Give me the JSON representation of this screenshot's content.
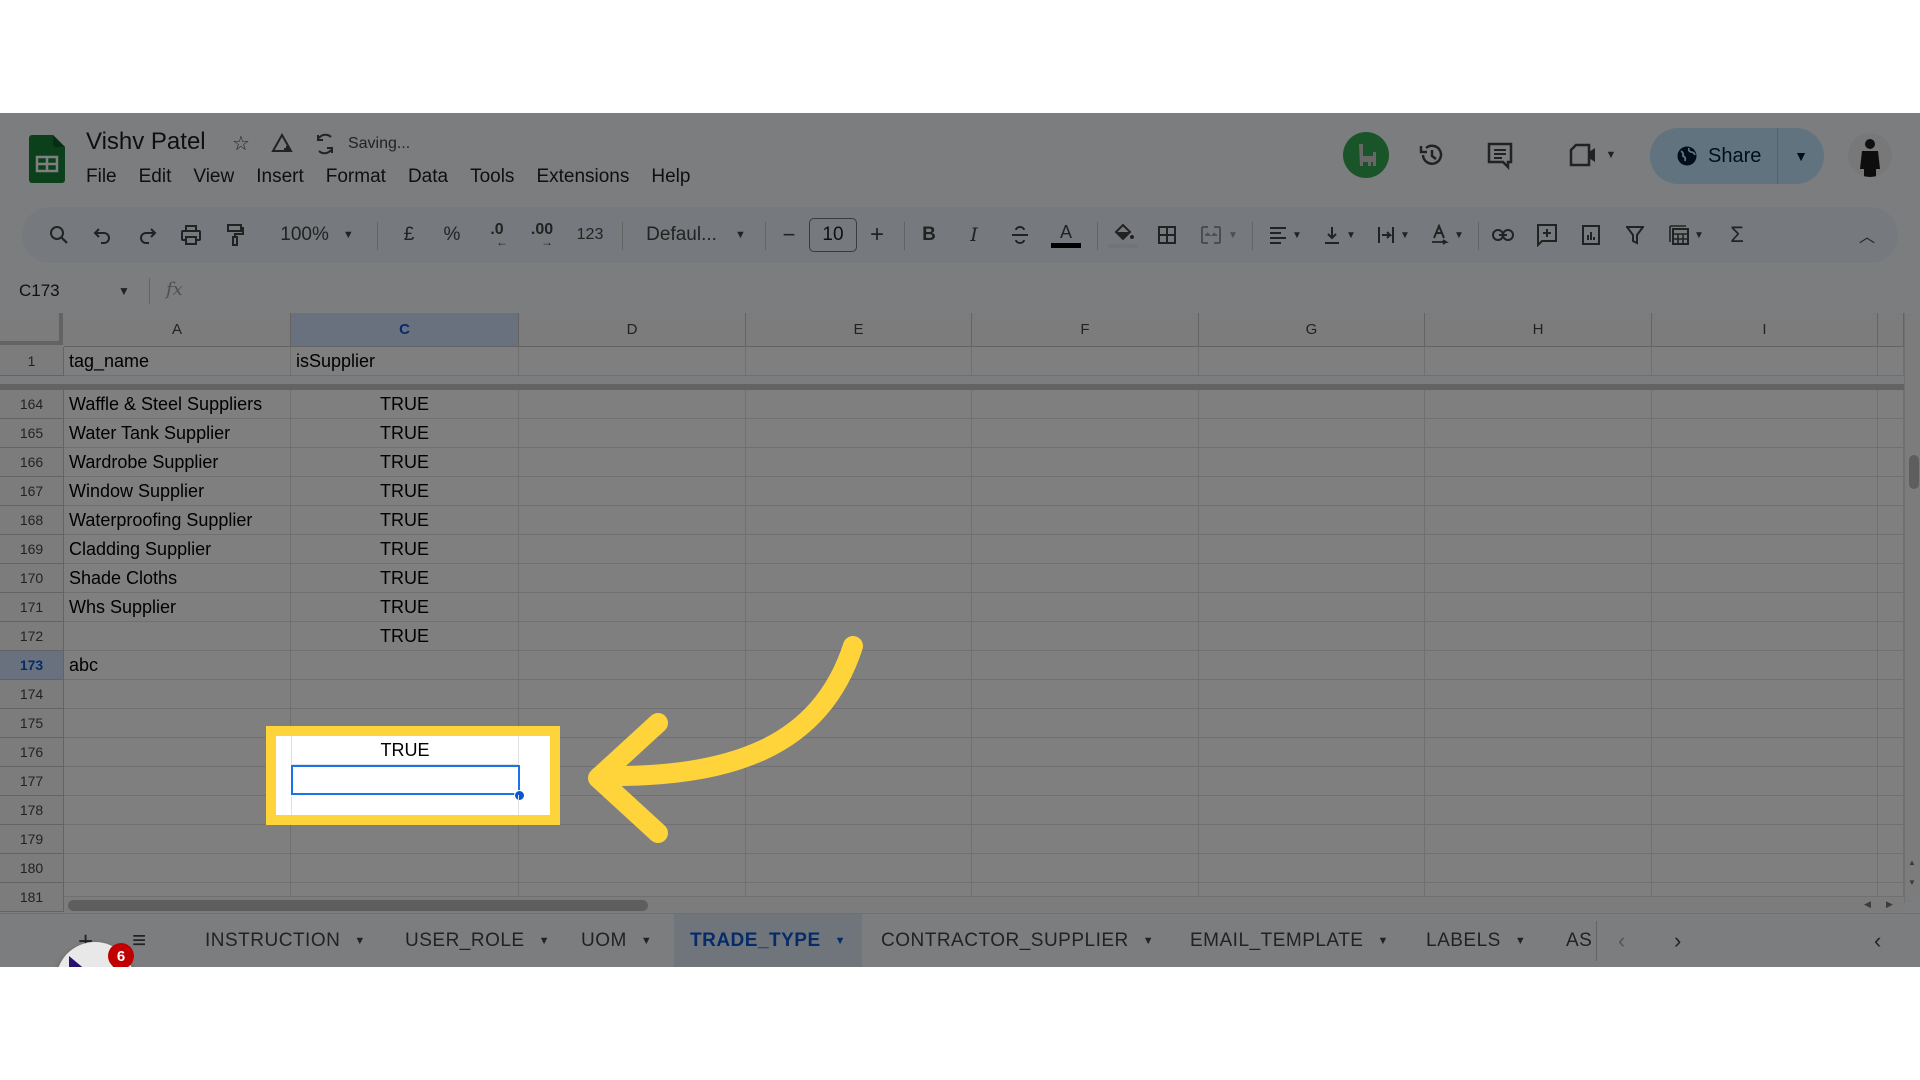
{
  "app": {
    "doc_title": "Vishv Patel",
    "save_status": "Saving...",
    "menu": [
      "File",
      "Edit",
      "View",
      "Insert",
      "Format",
      "Data",
      "Tools",
      "Extensions",
      "Help"
    ],
    "share_label": "Share"
  },
  "toolbar": {
    "zoom": "100%",
    "currency": "£",
    "percent": "%",
    "dec_decrease": ".0",
    "dec_increase": ".00",
    "number_format": "123",
    "font": "Defaul...",
    "font_size": "10",
    "minus": "−",
    "plus": "+",
    "bold": "B",
    "italic": "I",
    "sum": "Σ"
  },
  "formula_bar": {
    "name_box": "C173",
    "fx": "fx",
    "value": ""
  },
  "grid": {
    "columns": [
      "A",
      "C",
      "D",
      "E",
      "F",
      "G",
      "H",
      "I"
    ],
    "selected_column": "C",
    "header_row": {
      "row": "1",
      "A": "tag_name",
      "C": "isSupplier"
    },
    "rows": [
      {
        "row": "164",
        "A": "Waffle & Steel Suppliers",
        "C": "TRUE"
      },
      {
        "row": "165",
        "A": "Water Tank Supplier",
        "C": "TRUE"
      },
      {
        "row": "166",
        "A": "Wardrobe Supplier",
        "C": "TRUE"
      },
      {
        "row": "167",
        "A": "Window Supplier",
        "C": "TRUE"
      },
      {
        "row": "168",
        "A": "Waterproofing Supplier",
        "C": "TRUE"
      },
      {
        "row": "169",
        "A": "Cladding Supplier",
        "C": "TRUE"
      },
      {
        "row": "170",
        "A": "Shade Cloths",
        "C": "TRUE"
      },
      {
        "row": "171",
        "A": "Whs Supplier",
        "C": "TRUE"
      },
      {
        "row": "172",
        "A": "",
        "C": "TRUE"
      },
      {
        "row": "173",
        "A": "abc",
        "C": ""
      },
      {
        "row": "174",
        "A": "",
        "C": ""
      },
      {
        "row": "175",
        "A": "",
        "C": ""
      },
      {
        "row": "176",
        "A": "",
        "C": ""
      },
      {
        "row": "177",
        "A": "",
        "C": ""
      },
      {
        "row": "178",
        "A": "",
        "C": ""
      },
      {
        "row": "179",
        "A": "",
        "C": ""
      },
      {
        "row": "180",
        "A": "",
        "C": ""
      },
      {
        "row": "181",
        "A": "",
        "C": ""
      }
    ],
    "selected_row": "173",
    "active_cell": "C173"
  },
  "sheets": {
    "add_label": "+",
    "list_label": "≡",
    "tabs": [
      "INSTRUCTION",
      "USER_ROLE",
      "UOM",
      "TRADE_TYPE",
      "CONTRACTOR_SUPPLIER",
      "EMAIL_TEMPLATE",
      "LABELS",
      "AS"
    ],
    "active": "TRADE_TYPE"
  },
  "extension_badge": {
    "count": "6"
  },
  "colors": {
    "accent": "#0b57d0",
    "highlight": "#ffd43b",
    "sheets_green": "#188038",
    "share_bg": "#c2e7ff"
  }
}
